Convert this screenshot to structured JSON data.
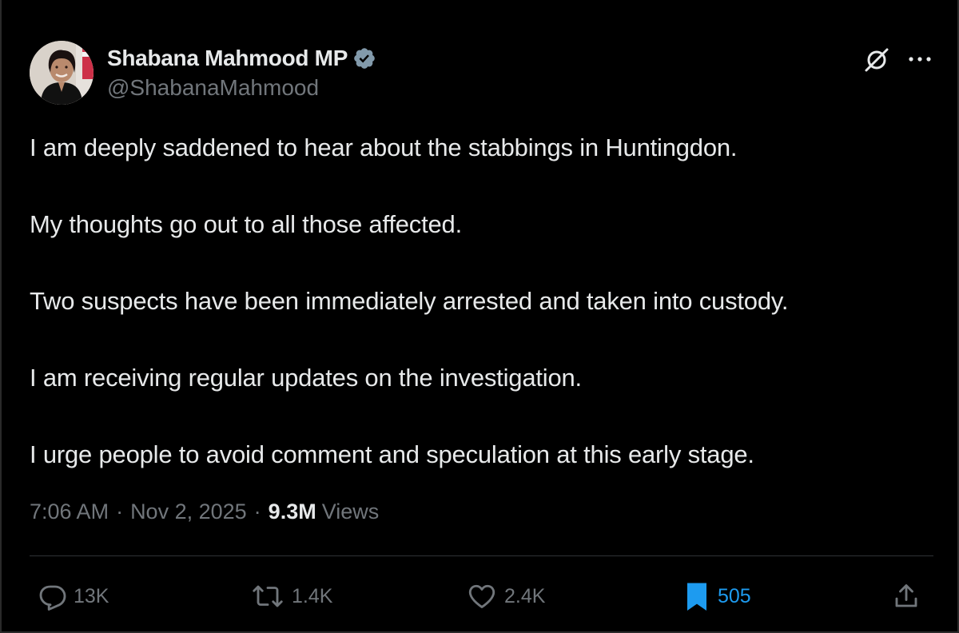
{
  "author": {
    "display_name": "Shabana Mahmood MP",
    "handle": "@ShabanaMahmood",
    "verified": true,
    "avatar_icon": "avatar-photo"
  },
  "header_icons": [
    "grok-icon",
    "more-icon"
  ],
  "tweet": {
    "paragraphs": [
      "I am deeply saddened to hear about the stabbings in Huntingdon.",
      "My thoughts go out to all those affected.",
      "Two suspects have been immediately arrested and taken into custody.",
      "I am receiving regular updates on the investigation.",
      "I urge people to avoid comment and speculation at this early stage."
    ],
    "time": "7:06 AM",
    "separator": "·",
    "date": "Nov 2, 2025",
    "views_count": "9.3M",
    "views_label": "Views"
  },
  "actions": {
    "replies": "13K",
    "reposts": "1.4K",
    "likes": "2.4K",
    "bookmarks": "505"
  },
  "colors": {
    "background": "#000000",
    "text": "#e7e9ea",
    "muted": "#71767b",
    "accent": "#1d9bf0",
    "verified_badge": "#829aab",
    "divider": "#2f3336"
  }
}
